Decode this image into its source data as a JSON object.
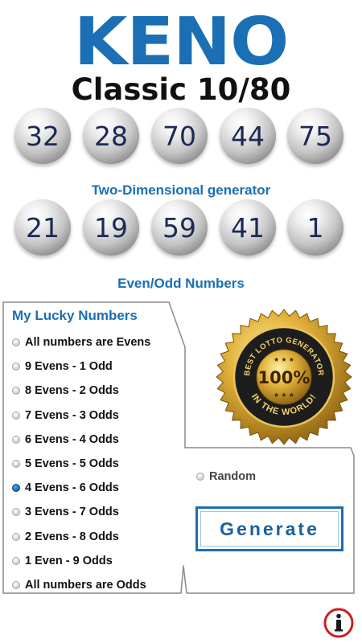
{
  "header": {
    "logo": "KENO",
    "subtitle": "Classic 10/80"
  },
  "draws": {
    "row1": [
      "32",
      "28",
      "70",
      "44",
      "75"
    ],
    "label2": "Two-Dimensional generator",
    "row2": [
      "21",
      "19",
      "59",
      "41",
      "1"
    ],
    "label3": "Even/Odd Numbers"
  },
  "panel": {
    "title": "My Lucky Numbers",
    "options": [
      "All numbers are Evens",
      "9 Evens - 1 Odd",
      "8 Evens - 2 Odds",
      "7 Evens - 3 Odds",
      "6 Evens - 4 Odds",
      "5 Evens - 5 Odds",
      "4 Evens - 6 Odds",
      "3 Evens - 7 Odds",
      "2 Evens - 8 Odds",
      "1 Even - 9 Odds",
      "All numbers are Odds"
    ],
    "selected_option": "4 Evens - 6 Odds",
    "random_label": "Random",
    "generate_label": "Generate"
  },
  "badge": {
    "top_text": "BEST LOTTO GENERATOR",
    "center_text": "100%",
    "bottom_text": "IN THE WORLD!"
  },
  "colors": {
    "accent": "#1a6fb5",
    "ball_text": "#1b2a55",
    "gold": "#d4a22a",
    "info_red": "#cc1f1f"
  },
  "icons": {
    "info": "info-icon",
    "badge": "gold-seal-badge"
  }
}
